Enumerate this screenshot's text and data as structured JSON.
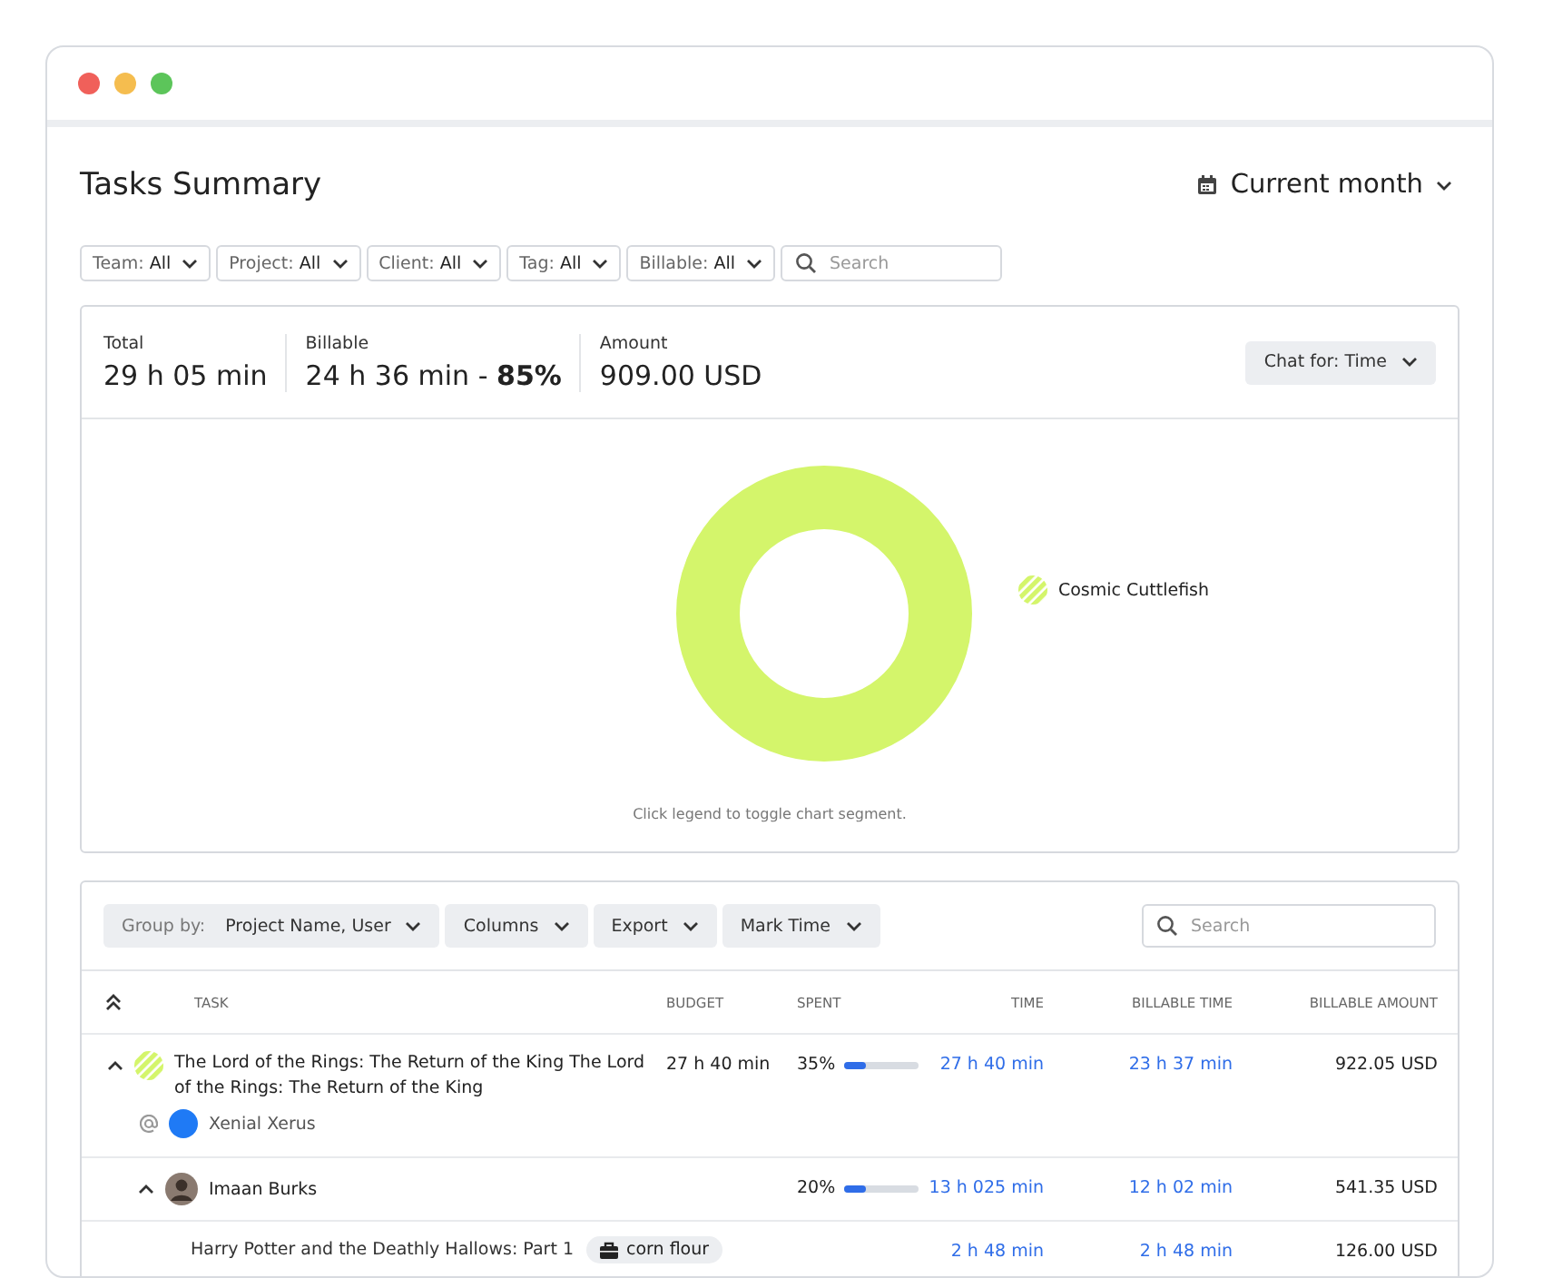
{
  "header": {
    "title": "Tasks Summary",
    "period": "Current month"
  },
  "filters": [
    {
      "label": "Team:",
      "value": "All"
    },
    {
      "label": "Project:",
      "value": "All"
    },
    {
      "label": "Client:",
      "value": "All"
    },
    {
      "label": "Tag:",
      "value": "All"
    },
    {
      "label": "Billable:",
      "value": "All"
    }
  ],
  "filter_search": {
    "placeholder": "Search"
  },
  "summary": {
    "stats": [
      {
        "label": "Total",
        "value": "29 h 05 min"
      },
      {
        "label": "Billable",
        "value": "24 h 36 min - **85%**"
      },
      {
        "label": "Amount",
        "value": "909.00 USD"
      }
    ],
    "chart_toggle": {
      "label": "Chat for:",
      "value": "Time"
    },
    "legend": [
      {
        "label": "Cosmic Cuttlefish",
        "color": "#d4f56b"
      }
    ],
    "hint": "Click legend to toggle chart segment."
  },
  "toolbar": {
    "buttons": [
      {
        "prefix": "Group by:",
        "label": "Project Name, User"
      },
      {
        "label": "Columns"
      },
      {
        "label": "Export"
      },
      {
        "label": "Mark Time"
      }
    ],
    "search": {
      "placeholder": "Search"
    }
  },
  "table": {
    "columns": [
      "TASK",
      "BUDGET",
      "SPENT",
      "TIME",
      "BILLABLE TIME",
      "BILLABLE AMOUNT"
    ],
    "rows": [
      {
        "kind": "project",
        "title": "The Lord of the Rings: The Return of the King The Lord of the Rings: The Return of the King",
        "color": "#d4f56b",
        "client": "Xenial Xerus",
        "budget": "27 h 40 min",
        "spent": "35%",
        "level": 0.3,
        "time": "27 h 40 min",
        "billable_time": "23 h 37 min",
        "amount": "922.05 USD",
        "expanded": true,
        "children": [
          {
            "kind": "user",
            "title": "Imaan Burks",
            "spent": "20%",
            "level": 0.3,
            "time": "13 h 025 min",
            "billable_time": "12 h 02 min",
            "amount": "541.35 USD",
            "expanded": true,
            "children": [
              {
                "kind": "task",
                "title": "Harry Potter and the Deathly Hallows: Part 1",
                "tag": "corn flour",
                "time": "2 h 48 min",
                "billable_time": "2 h 48 min",
                "amount": "126.00 USD"
              }
            ]
          }
        ]
      }
    ]
  }
}
